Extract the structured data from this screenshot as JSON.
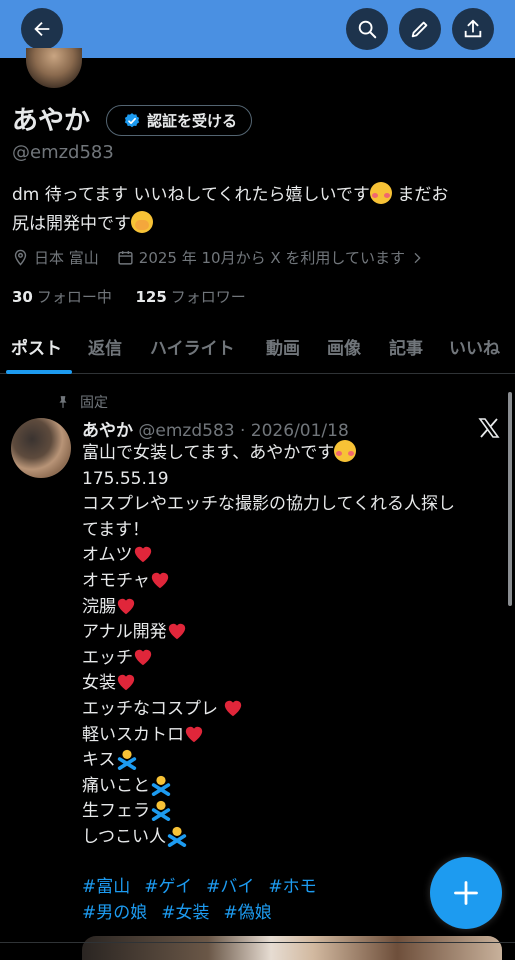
{
  "nav": {
    "back_icon": "arrow-left-icon",
    "search_icon": "search-icon",
    "compose_icon": "pencil-icon",
    "share_icon": "share-icon"
  },
  "profile": {
    "name": "あやか",
    "verify_label": "認証を受ける",
    "handle": "@emzd583",
    "bio_line1_text": "dm 待ってます いいねしてくれたら嬉しいです",
    "bio_line1_after": " まだお",
    "bio_line2_text": "尻は開発中です",
    "location": "日本 富山",
    "joined": "2025 年 10月から X を利用しています",
    "following_count": "30",
    "following_label": "フォロー中",
    "followers_count": "125",
    "followers_label": "フォロワー"
  },
  "tabs": [
    "ポスト",
    "返信",
    "ハイライト",
    "動画",
    "画像",
    "記事",
    "いいね"
  ],
  "post": {
    "pinned_label": "固定",
    "author": "あやか",
    "meta": "@emzd583 · 2026/01/18",
    "lines": [
      "富山で女装してます、あやかです",
      "175.55.19",
      "コスプレやエッチな撮影の協力してくれる人探し",
      "てます！",
      "オムツ",
      "オモチャ",
      "浣腸",
      "アナル開発",
      "エッチ",
      "女装",
      "エッチなコスプレ",
      "軽いスカトロ",
      "キス",
      "痛いこと",
      "生フェラ",
      "しつこい人"
    ],
    "hashtags": [
      "#富山",
      "#ゲイ",
      "#バイ",
      "#ホモ",
      "#男の娘",
      "#女装",
      "#偽娘"
    ]
  },
  "colors": {
    "accent": "#1d9bf0",
    "header": "#4a90e2",
    "muted": "#71767b",
    "heart": "#e0263a"
  }
}
